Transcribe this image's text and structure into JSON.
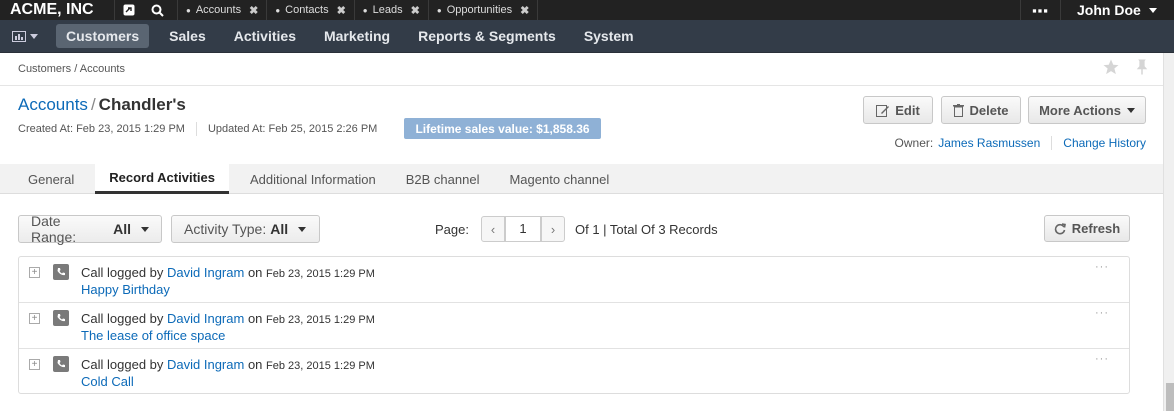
{
  "topbar": {
    "brand": "ACME, INC",
    "pinned_tabs": [
      "Accounts",
      "Contacts",
      "Leads",
      "Opportunities"
    ],
    "user": "John Doe"
  },
  "nav": {
    "items": [
      "Customers",
      "Sales",
      "Activities",
      "Marketing",
      "Reports & Segments",
      "System"
    ],
    "active": "Customers"
  },
  "breadcrumb": "Customers / Accounts",
  "record": {
    "entity": "Accounts",
    "separator": "/",
    "name": "Chandler's",
    "created": "Created At: Feb 23, 2015 1:29 PM",
    "updated": "Updated At: Feb 25, 2015 2:26 PM",
    "lifetime_value": "Lifetime sales value: $1,858.36"
  },
  "actions": {
    "edit": "Edit",
    "delete": "Delete",
    "more": "More Actions"
  },
  "owner": {
    "label": "Owner:",
    "name": "James Rasmussen",
    "history": "Change History"
  },
  "tabs": [
    "General",
    "Record Activities",
    "Additional Information",
    "B2B channel",
    "Magento channel"
  ],
  "filters": {
    "date_label": "Date Range:",
    "date_value": "All",
    "type_label": "Activity Type:",
    "type_value": "All"
  },
  "pager": {
    "label": "Page:",
    "current": "1",
    "summary": "Of 1 | Total Of 3 Records",
    "refresh": "Refresh"
  },
  "activities": [
    {
      "prefix": "Call logged by",
      "user": "David Ingram",
      "on": "on",
      "date": "Feb 23, 2015 1:29 PM",
      "subject": "Happy Birthday"
    },
    {
      "prefix": "Call logged by",
      "user": "David Ingram",
      "on": "on",
      "date": "Feb 23, 2015 1:29 PM",
      "subject": "The lease of office space"
    },
    {
      "prefix": "Call logged by",
      "user": "David Ingram",
      "on": "on",
      "date": "Feb 23, 2015 1:29 PM",
      "subject": "Cold Call"
    }
  ],
  "colors": {
    "topbar": "#222222",
    "nav": "#333c48",
    "link": "#0c6ab8",
    "lifetime_badge": "#8fb1d6"
  }
}
